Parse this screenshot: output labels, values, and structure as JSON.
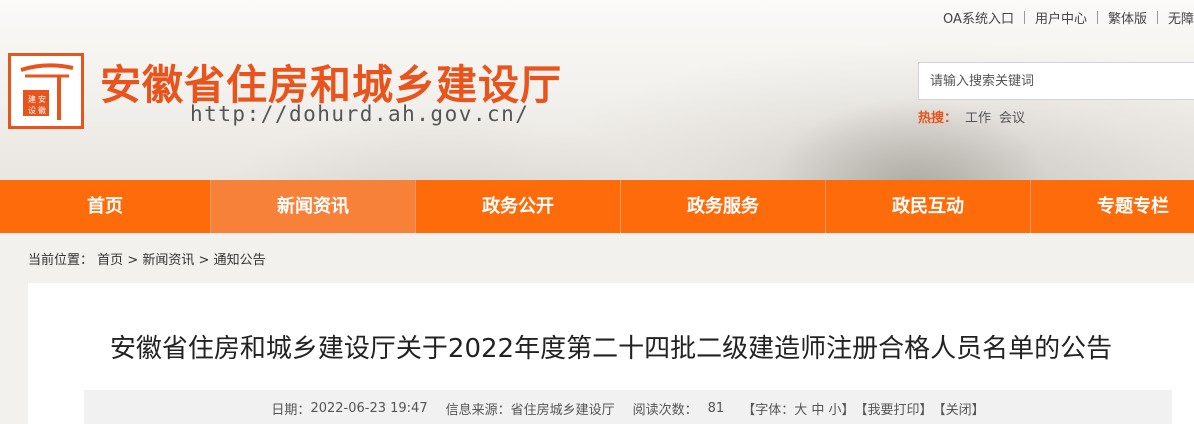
{
  "top_links": [
    "OA系统入口",
    "用户中心",
    "繁体版",
    "无障"
  ],
  "logo": {
    "seal_text": "建设安徽"
  },
  "site": {
    "title": "安徽省住房和城乡建设厅",
    "url": "http://dohurd.ah.gov.cn/"
  },
  "search": {
    "placeholder": "请输入搜索关键词"
  },
  "hot": {
    "label": "热搜：",
    "words": [
      "工作",
      "会议"
    ]
  },
  "nav": {
    "items": [
      "首页",
      "新闻资讯",
      "政务公开",
      "政务服务",
      "政民互动",
      "专题专栏"
    ],
    "active": "新闻资讯"
  },
  "breadcrumb": {
    "label": "当前位置：",
    "items": [
      "首页",
      "新闻资讯",
      "通知公告"
    ],
    "sep": ">"
  },
  "article": {
    "title": "安徽省住房和城乡建设厅关于2022年度第二十四批二级建造师注册合格人员名单的公告",
    "date_label": "日期：",
    "date": "2022-06-23 19:47",
    "source_label": "信息来源：",
    "source": "省住房城乡建设厅",
    "views_label": "阅读次数：",
    "views": "81",
    "font_label": "【字体：",
    "font_sizes": [
      "大",
      "中",
      "小"
    ],
    "font_close": "】",
    "print": "【我要打印】",
    "close": "【关闭】"
  },
  "colors": {
    "brand": "#e8541c",
    "nav_bg": "#fe6b0b",
    "nav_active": "#f8813a"
  }
}
